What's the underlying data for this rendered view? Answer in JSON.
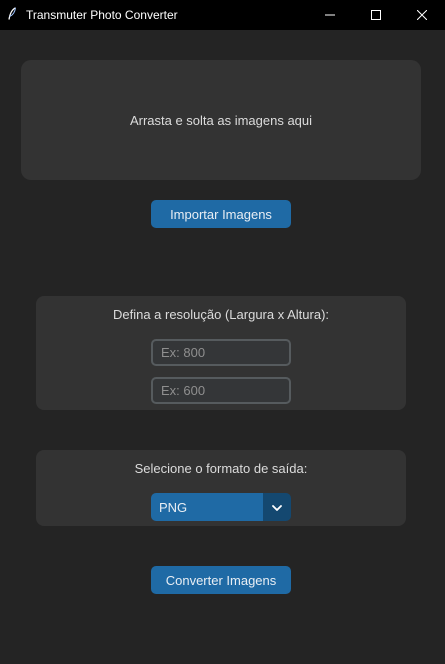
{
  "window": {
    "title": "Transmuter Photo Converter"
  },
  "drop_zone": {
    "text": "Arrasta e solta as imagens aqui"
  },
  "import_button": {
    "label": "Importar Imagens"
  },
  "resolution": {
    "label": "Defina a resolução (Largura x Altura):",
    "width_placeholder": "Ex: 800",
    "height_placeholder": "Ex: 600",
    "width_value": "",
    "height_value": ""
  },
  "format": {
    "label": "Selecione o formato de saída:",
    "selected": "PNG"
  },
  "convert_button": {
    "label": "Converter Imagens"
  },
  "icons": {
    "app": "feather-icon",
    "minimize": "minimize-icon",
    "maximize": "maximize-icon",
    "close": "close-icon",
    "dropdown": "chevron-down-icon"
  },
  "colors": {
    "accent": "#1f6aa5",
    "accent_dark": "#144870",
    "background": "#242424",
    "panel": "#333333",
    "titlebar": "#000000"
  }
}
